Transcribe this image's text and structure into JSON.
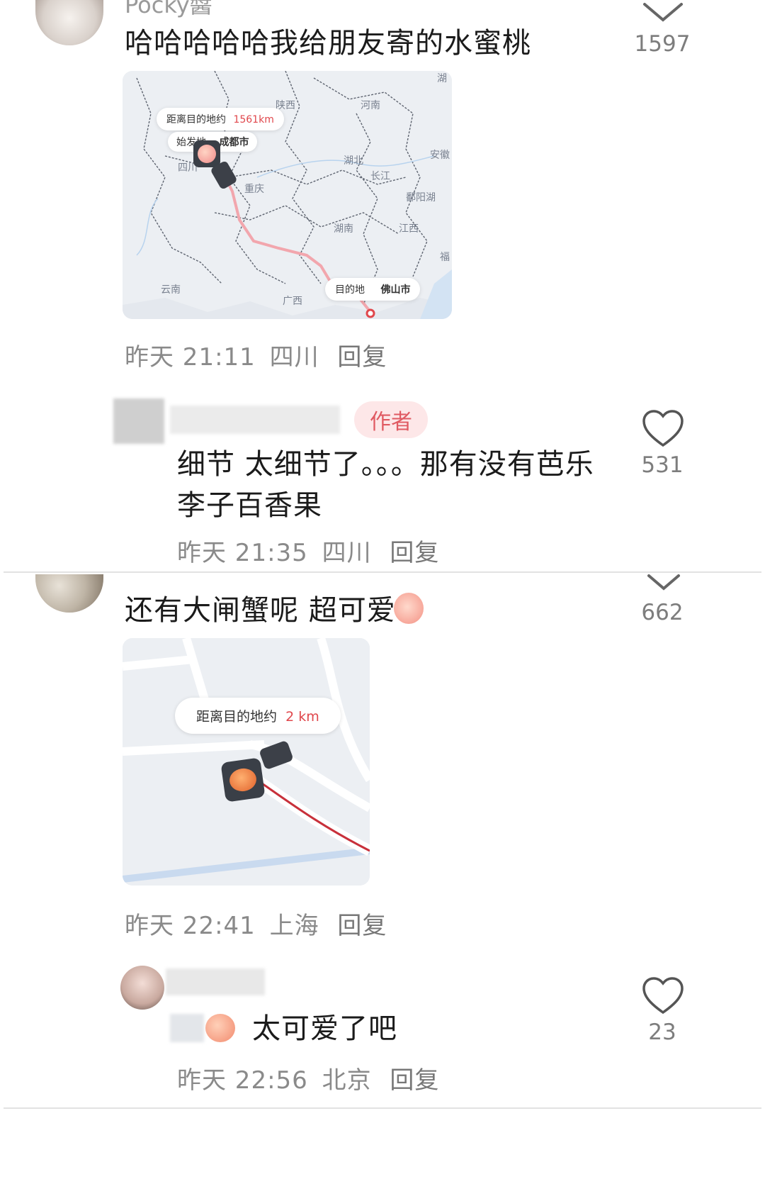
{
  "comments": [
    {
      "username": "Pocky醬",
      "text": "哈哈哈哈哈我给朋友寄的水蜜桃",
      "time": "昨天 21:11",
      "location": "四川",
      "reply": "回复",
      "likes": "1597",
      "map": {
        "distance_label": "距离目的地约",
        "distance_value": "1561km",
        "origin_label": "始发地",
        "origin_city": "成都市",
        "dest_label": "目的地",
        "dest_city": "佛山市",
        "provinces": [
          "陕西",
          "河南",
          "湖北",
          "长江",
          "安徽",
          "四川",
          "重庆",
          "鄱阳湖",
          "湖南",
          "江西",
          "福",
          "云南",
          "广西",
          "湖"
        ]
      }
    },
    {
      "username": "",
      "author_tag": "作者",
      "text": "细节 太细节了。。。那有没有芭乐李子百香果",
      "time": "昨天 21:35",
      "location": "四川",
      "reply": "回复",
      "likes": "531"
    },
    {
      "username": "",
      "text": "还有大闸蟹呢 超可爱",
      "time": "昨天 22:41",
      "location": "上海",
      "reply": "回复",
      "likes": "662",
      "map": {
        "distance_label": "距离目的地约",
        "distance_value": "2 km"
      }
    },
    {
      "username": "",
      "text": "太可爱了吧",
      "time": "昨天 22:56",
      "location": "北京",
      "reply": "回复",
      "likes": "23"
    }
  ],
  "colors": {
    "accent": "#e0474c",
    "route": "#e8a0a6",
    "muted": "#8a8a8a"
  }
}
